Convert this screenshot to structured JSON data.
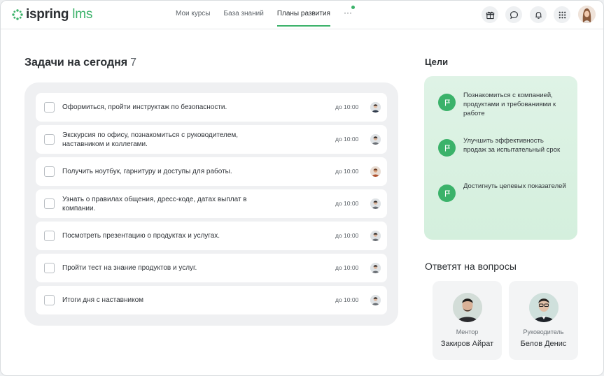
{
  "brand": {
    "name": "ispring",
    "product": "lms",
    "accent": "#3bb26a"
  },
  "nav": {
    "items": [
      {
        "label": "Мои курсы"
      },
      {
        "label": "База знаний"
      },
      {
        "label": "Планы развития",
        "active": true
      }
    ],
    "more": "···"
  },
  "header_actions": [
    "gift-icon",
    "chat-icon",
    "bell-icon",
    "apps-icon",
    "user-avatar"
  ],
  "tasks": {
    "title": "Задачи на сегодня",
    "count": "7",
    "items": [
      {
        "text": "Оформиться, пройти инструктаж по безопасности.",
        "time": "до 10:00",
        "checked": false
      },
      {
        "text": "Экскурсия по офису, познакомиться с руководителем, наставником и коллегами.",
        "time": "до 10:00",
        "checked": false
      },
      {
        "text": "Получить ноутбук, гарнитуру и доступы для работы.",
        "time": "до 10:00",
        "checked": false
      },
      {
        "text": "Узнать о правилах общения, дресс-коде, датах выплат в компании.",
        "time": "до 10:00",
        "checked": false
      },
      {
        "text": "Посмотреть презентацию о продуктах и услугах.",
        "time": "до 10:00",
        "checked": false
      },
      {
        "text": "Пройти тест на знание продуктов и услуг.",
        "time": "до 10:00",
        "checked": false
      },
      {
        "text": "Итоги дня с наставником",
        "time": "до 10:00",
        "checked": false
      }
    ]
  },
  "goals": {
    "title": "Цели",
    "items": [
      {
        "text": "Познакомиться с компанией, продуктами и требованиями к работе"
      },
      {
        "text": "Улучшить эффективность продаж за испытательный срок"
      },
      {
        "text": "Достигнуть целевых показателей"
      }
    ]
  },
  "answers": {
    "title": "Ответят на вопросы",
    "people": [
      {
        "role": "Ментор",
        "name": "Закиров Айрат"
      },
      {
        "role": "Руководитель",
        "name": "Белов Денис"
      }
    ]
  }
}
